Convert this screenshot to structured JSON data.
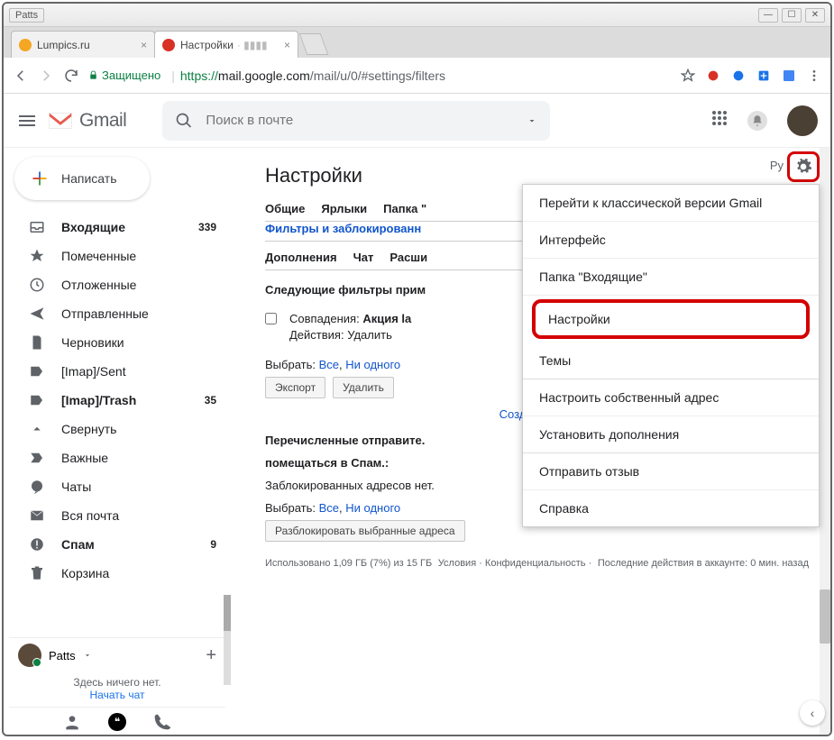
{
  "window": {
    "user": "Patts",
    "minimize": "—",
    "maximize": "☐",
    "close": "✕"
  },
  "browser_tabs": [
    {
      "title": "Lumpics.ru",
      "favicon_color": "#f5a623",
      "active": false
    },
    {
      "title": "Настройки",
      "favicon_color": "#d93025",
      "active": true
    }
  ],
  "omnibox": {
    "secure_label": "Защищено",
    "url_https": "https://",
    "url_host": "mail.google.com",
    "url_path": "/mail/u/0/#settings/filters"
  },
  "gmail": {
    "product": "Gmail",
    "search_placeholder": "Поиск в почте",
    "compose": "Написать"
  },
  "sidebar_items": [
    {
      "icon": "inbox",
      "label": "Входящие",
      "count": "339",
      "bold": true
    },
    {
      "icon": "star",
      "label": "Помеченные",
      "count": "",
      "bold": false
    },
    {
      "icon": "clock",
      "label": "Отложенные",
      "count": "",
      "bold": false
    },
    {
      "icon": "send",
      "label": "Отправленные",
      "count": "",
      "bold": false
    },
    {
      "icon": "draft",
      "label": "Черновики",
      "count": "",
      "bold": false
    },
    {
      "icon": "label",
      "label": "[Imap]/Sent",
      "count": "",
      "bold": false
    },
    {
      "icon": "label",
      "label": "[Imap]/Trash",
      "count": "35",
      "bold": true
    },
    {
      "icon": "collapse",
      "label": "Свернуть",
      "count": "",
      "bold": false
    },
    {
      "icon": "important",
      "label": "Важные",
      "count": "",
      "bold": false
    },
    {
      "icon": "chat",
      "label": "Чаты",
      "count": "",
      "bold": false
    },
    {
      "icon": "mail",
      "label": "Вся почта",
      "count": "",
      "bold": false
    },
    {
      "icon": "spam",
      "label": "Спам",
      "count": "9",
      "bold": true
    },
    {
      "icon": "trash",
      "label": "Корзина",
      "count": "",
      "bold": false
    }
  ],
  "hangouts": {
    "name": "Patts",
    "empty": "Здесь ничего нет.",
    "start": "Начать чат"
  },
  "settings": {
    "title": "Настройки",
    "lang_short": "Ру",
    "tabs_row1": [
      "Общие",
      "Ярлыки",
      "Папка \""
    ],
    "active_tab": "Фильтры и заблокированн",
    "tabs_row2": [
      "Дополнения",
      "Чат",
      "Расши"
    ],
    "section1_head": "Следующие фильтры прим",
    "filter_match_label": "Совпадения:",
    "filter_match_value": "Акция la",
    "filter_action_label": "Действия:",
    "filter_action_value": "Удалить",
    "select_label": "Выбрать:",
    "select_all": "Все",
    "select_none": "Ни одного",
    "btn_export": "Экспорт",
    "btn_delete": "Удалить",
    "create_new": "Создать новы",
    "section2_head": "Перечисленные отправите.",
    "section2_sub": "помещаться в Спам.:",
    "no_blocked": "Заблокированных адресов нет.",
    "btn_unblock": "Разблокировать выбранные адреса"
  },
  "dropdown": [
    "Перейти к классической версии Gmail",
    "Интерфейс",
    "Папка \"Входящие\"",
    "Настройки",
    "Темы",
    "Настроить собственный адрес",
    "Установить дополнения",
    "Отправить отзыв",
    "Справка"
  ],
  "footer": {
    "storage": "Использовано 1,09 ГБ (7%) из 15 ГБ",
    "terms": "Условия · Конфиденциальность ·",
    "activity": "Последние действия в аккаунте: 0 мин. назад"
  }
}
